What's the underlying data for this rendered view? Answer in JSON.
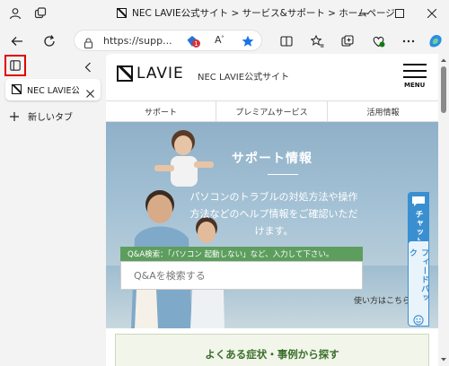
{
  "window": {
    "title": "NEC LAVIE公式サイト > サービス&サポート > ホームページ"
  },
  "toolbar": {
    "url": "https://supp...",
    "tracking_badge": "1"
  },
  "sidebar": {
    "tab_label": "NEC LAVIE公式サイト",
    "new_tab_label": "新しいタブ"
  },
  "site": {
    "brand": "LAVIE",
    "site_name": "NEC LAVIE公式サイト",
    "menu_label": "MENU",
    "nav": [
      "サポート",
      "プレミアムサービス",
      "活用情報"
    ]
  },
  "hero": {
    "title": "サポート情報",
    "description": "パソコンのトラブルの対処方法や操作方法などのヘルプ情報をご確認いただけます。",
    "qa_hint": "Q&A検索：「パソコン 起動しない」など、入力して下さい。",
    "qa_placeholder": "Q&Aを検索する",
    "howto": "使い方はこちら"
  },
  "faq": {
    "title": "よくある症状・事例から探す"
  },
  "floating": {
    "chat": "チャット",
    "feedback": "フィードバック"
  }
}
